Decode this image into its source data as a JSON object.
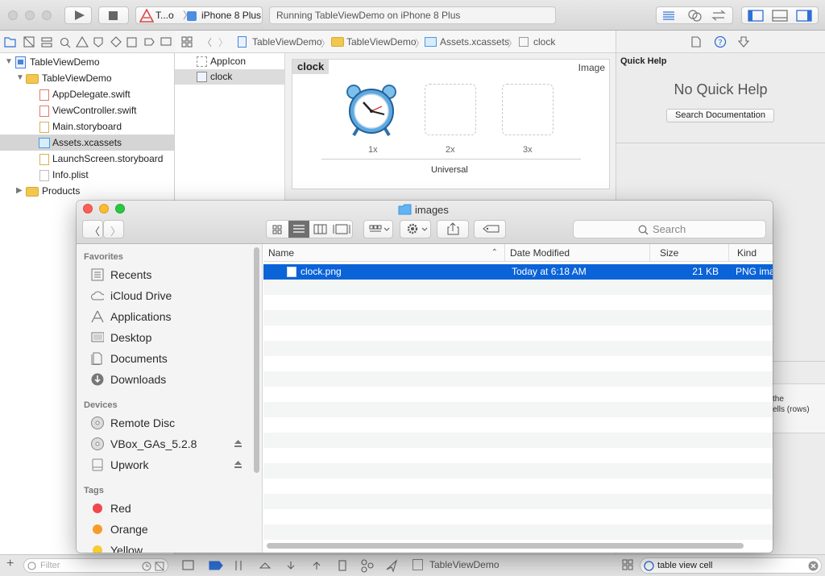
{
  "xcode": {
    "scheme": "T...o",
    "device": "iPhone 8 Plus",
    "activity": "Running TableViewDemo on iPhone 8 Plus"
  },
  "navigator": {
    "items": [
      {
        "label": "TableViewDemo",
        "type": "project"
      },
      {
        "label": "TableViewDemo",
        "type": "folder"
      },
      {
        "label": "AppDelegate.swift",
        "type": "swift"
      },
      {
        "label": "ViewController.swift",
        "type": "swift"
      },
      {
        "label": "Main.storyboard",
        "type": "storyboard"
      },
      {
        "label": "Assets.xcassets",
        "type": "assets",
        "selected": true
      },
      {
        "label": "LaunchScreen.storyboard",
        "type": "storyboard"
      },
      {
        "label": "Info.plist",
        "type": "plist"
      },
      {
        "label": "Products",
        "type": "folder"
      }
    ],
    "filter_placeholder": "Filter"
  },
  "jumpbar": [
    "TableViewDemo",
    "TableViewDemo",
    "Assets.xcassets",
    "clock"
  ],
  "assets": {
    "list": [
      {
        "label": "AppIcon"
      },
      {
        "label": "clock",
        "selected": true
      }
    ],
    "set_name": "clock",
    "set_type": "Image",
    "slots": [
      "1x",
      "2x",
      "3x"
    ],
    "universal": "Universal"
  },
  "inspector": {
    "quick_help": "Quick Help",
    "no_help": "No Quick Help",
    "search_docs": "Search Documentation",
    "snippet_line1": "the",
    "snippet_line2": "ells (rows)",
    "library_search": "table view cell"
  },
  "debugbar": {
    "target": "TableViewDemo"
  },
  "finder": {
    "title": "images",
    "search_placeholder": "Search",
    "sidebar": {
      "favorites_title": "Favorites",
      "favorites": [
        {
          "label": "Recents",
          "icon": "recents-icon"
        },
        {
          "label": "iCloud Drive",
          "icon": "cloud-icon"
        },
        {
          "label": "Applications",
          "icon": "applications-icon"
        },
        {
          "label": "Desktop",
          "icon": "desktop-icon"
        },
        {
          "label": "Documents",
          "icon": "documents-icon"
        },
        {
          "label": "Downloads",
          "icon": "downloads-icon"
        }
      ],
      "devices_title": "Devices",
      "devices": [
        {
          "label": "Remote Disc",
          "icon": "disc-icon"
        },
        {
          "label": "VBox_GAs_5.2.8",
          "icon": "disc-icon",
          "eject": true
        },
        {
          "label": "Upwork",
          "icon": "drive-icon",
          "eject": true
        }
      ],
      "tags_title": "Tags",
      "tags": [
        {
          "label": "Red",
          "color": "#f0484e"
        },
        {
          "label": "Orange",
          "color": "#f89b2a"
        },
        {
          "label": "Yellow",
          "color": "#f8cb2e"
        }
      ]
    },
    "columns": {
      "name": "Name",
      "date": "Date Modified",
      "size": "Size",
      "kind": "Kind"
    },
    "files": [
      {
        "name": "clock.png",
        "date": "Today at 6:18 AM",
        "size": "21 KB",
        "kind": "PNG ima"
      }
    ]
  },
  "colors": {
    "selection": "#0b63d8",
    "xcode_accent": "#2f6fd6"
  }
}
